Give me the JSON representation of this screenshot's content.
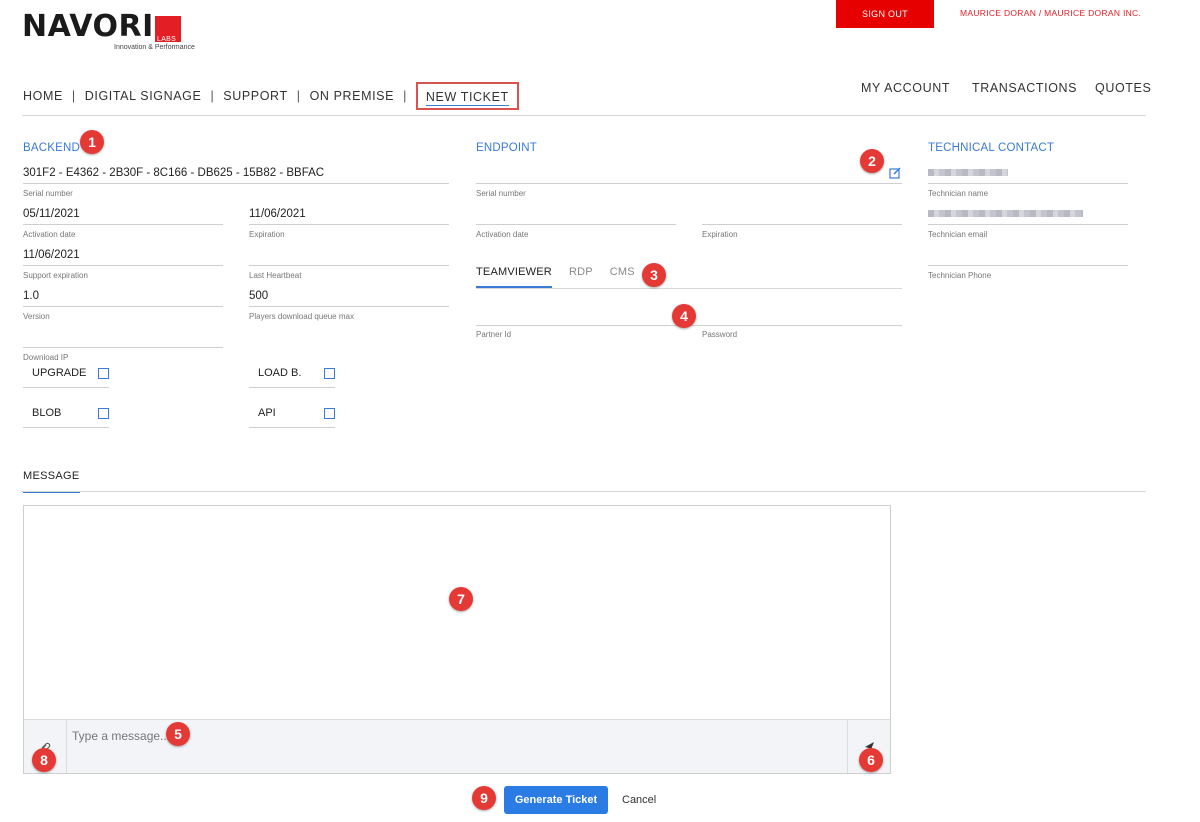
{
  "brand": {
    "name": "NAVORI",
    "labs": "LABS",
    "tagline": "Innovation & Performance"
  },
  "header": {
    "signout_label": "SIGN OUT",
    "user_label": "MAURICE DORAN / MAURICE DORAN INC."
  },
  "nav": {
    "left": [
      "HOME",
      "DIGITAL SIGNAGE",
      "SUPPORT",
      "ON PREMISE",
      "NEW TICKET"
    ],
    "separator": "|",
    "right": [
      "MY ACCOUNT",
      "TRANSACTIONS",
      "QUOTES"
    ]
  },
  "backend": {
    "title": "BACKEND",
    "serial": {
      "value": "301F2 - E4362 - 2B30F - 8C166 - DB625 - 15B82 - BBFAC",
      "label": "Serial number"
    },
    "activation": {
      "value": "05/11/2021",
      "label": "Activation date"
    },
    "expiration": {
      "value": "11/06/2021",
      "label": "Expiration"
    },
    "support_expiration": {
      "value": "11/06/2021",
      "label": "Support expiration"
    },
    "last_heartbeat": {
      "value": "",
      "label": "Last Heartbeat"
    },
    "version": {
      "value": "1.0",
      "label": "Version"
    },
    "queue_max": {
      "value": "500",
      "label": "Players download queue max"
    },
    "download_ip": {
      "value": "",
      "label": "Download IP"
    },
    "options": [
      "UPGRADE",
      "LOAD B.",
      "BLOB",
      "API"
    ]
  },
  "endpoint": {
    "title": "ENDPOINT",
    "serial": {
      "value": "",
      "label": "Serial number"
    },
    "activation": {
      "value": "",
      "label": "Activation date"
    },
    "expiration": {
      "value": "",
      "label": "Expiration"
    },
    "tabs": [
      "TEAMVIEWER",
      "RDP",
      "CMS"
    ],
    "partner": {
      "value": "",
      "label": "Partner Id"
    },
    "password": {
      "value": "",
      "label": "Password"
    }
  },
  "contact": {
    "title": "TECHNICAL CONTACT",
    "name_label": "Technician name",
    "email_label": "Technician email",
    "phone": {
      "value": "",
      "label": "Technician Phone"
    }
  },
  "message": {
    "tab": "MESSAGE",
    "placeholder": "Type a message..."
  },
  "actions": {
    "generate": "Generate Ticket",
    "cancel": "Cancel"
  },
  "badges": [
    "1",
    "2",
    "3",
    "4",
    "5",
    "6",
    "7",
    "8",
    "9"
  ],
  "colors": {
    "brand_red": "#e31e24",
    "accent_blue": "#3a7bd5",
    "button_blue": "#2b7be4",
    "badge_red": "#e53935"
  },
  "icons": [
    "edit-icon",
    "paperclip-icon",
    "send-icon"
  ]
}
